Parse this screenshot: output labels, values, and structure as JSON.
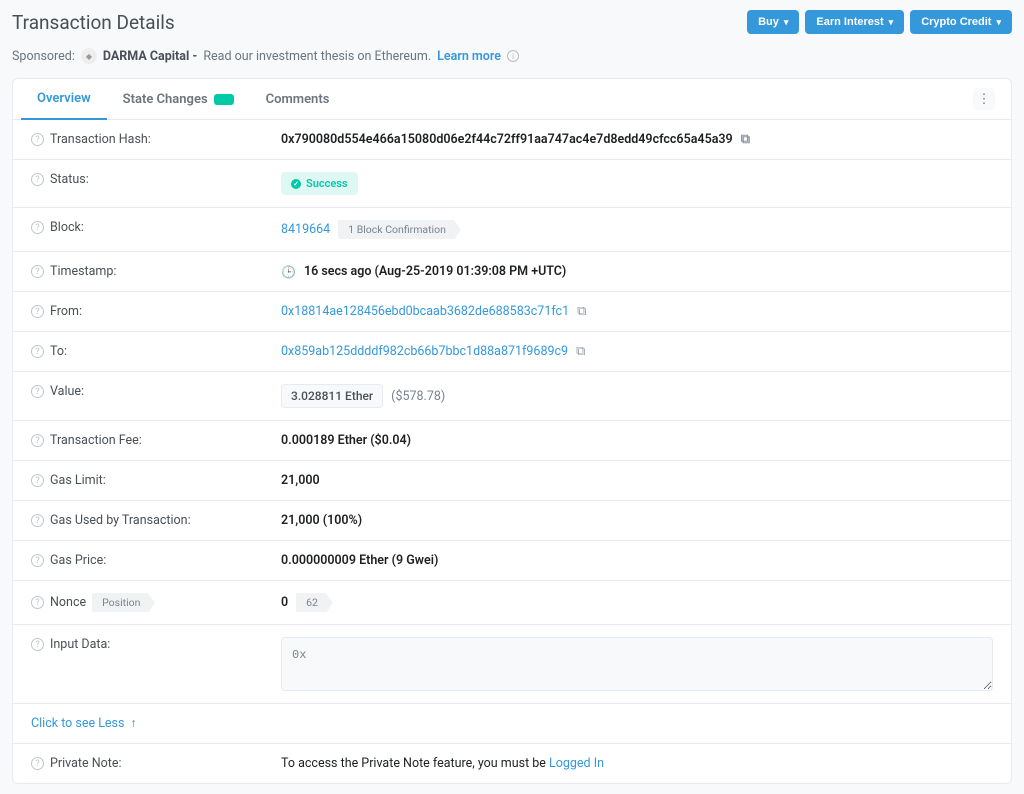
{
  "page_title": "Transaction Details",
  "header_buttons": {
    "buy": "Buy",
    "earn": "Earn Interest",
    "credit": "Crypto Credit"
  },
  "sponsored": {
    "prefix": "Sponsored:",
    "name": "DARMA Capital -",
    "text": "Read our investment thesis on Ethereum.",
    "link": "Learn more"
  },
  "tabs": {
    "overview": "Overview",
    "state": "State Changes",
    "comments": "Comments"
  },
  "labels": {
    "hash": "Transaction Hash:",
    "status": "Status:",
    "block": "Block:",
    "timestamp": "Timestamp:",
    "from": "From:",
    "to": "To:",
    "value": "Value:",
    "fee": "Transaction Fee:",
    "gas_limit": "Gas Limit:",
    "gas_used": "Gas Used by Transaction:",
    "gas_price": "Gas Price:",
    "nonce": "Nonce",
    "nonce_position": "Position",
    "input": "Input Data:",
    "private_note": "Private Note:"
  },
  "values": {
    "hash": "0x790080d554e466a15080d06e2f44c72ff91aa747ac4e7d8edd49cfcc65a45a39",
    "status": "Success",
    "block": "8419664",
    "block_conf": "1 Block Confirmation",
    "timestamp": "16 secs ago (Aug-25-2019 01:39:08 PM +UTC)",
    "from": "0x18814ae128456ebd0bcaab3682de688583c71fc1",
    "to": "0x859ab125ddddf982cb66b7bbc1d88a871f9689c9",
    "value_eth": "3.028811 Ether",
    "value_usd": "($578.78)",
    "fee": "0.000189 Ether ($0.04)",
    "gas_limit": "21,000",
    "gas_used": "21,000 (100%)",
    "gas_price": "0.000000009 Ether (9 Gwei)",
    "nonce": "0",
    "nonce_pos": "62",
    "input": "0x",
    "see_less": "Click to see Less",
    "private_note_prefix": "To access the Private Note feature, you must be ",
    "private_note_link": "Logged In"
  }
}
